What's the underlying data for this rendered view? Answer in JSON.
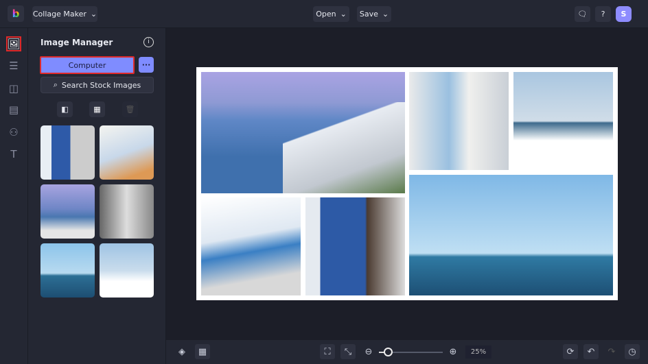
{
  "app": {
    "title": "Collage Maker",
    "logo": "b"
  },
  "header": {
    "open_label": "Open",
    "save_label": "Save",
    "avatar_letter": "S"
  },
  "rail": [
    "image-icon",
    "sliders-icon",
    "layout-icon",
    "texture-icon",
    "shapes-icon",
    "text-icon"
  ],
  "panel": {
    "title": "Image Manager",
    "computer_label": "Computer",
    "more_label": "···",
    "search_label": "Search Stock Images"
  },
  "bottom": {
    "zoom": "25%",
    "zoom_level": 25
  },
  "colors": {
    "accent": "#7f8cff",
    "highlight": "#e02a2a"
  }
}
